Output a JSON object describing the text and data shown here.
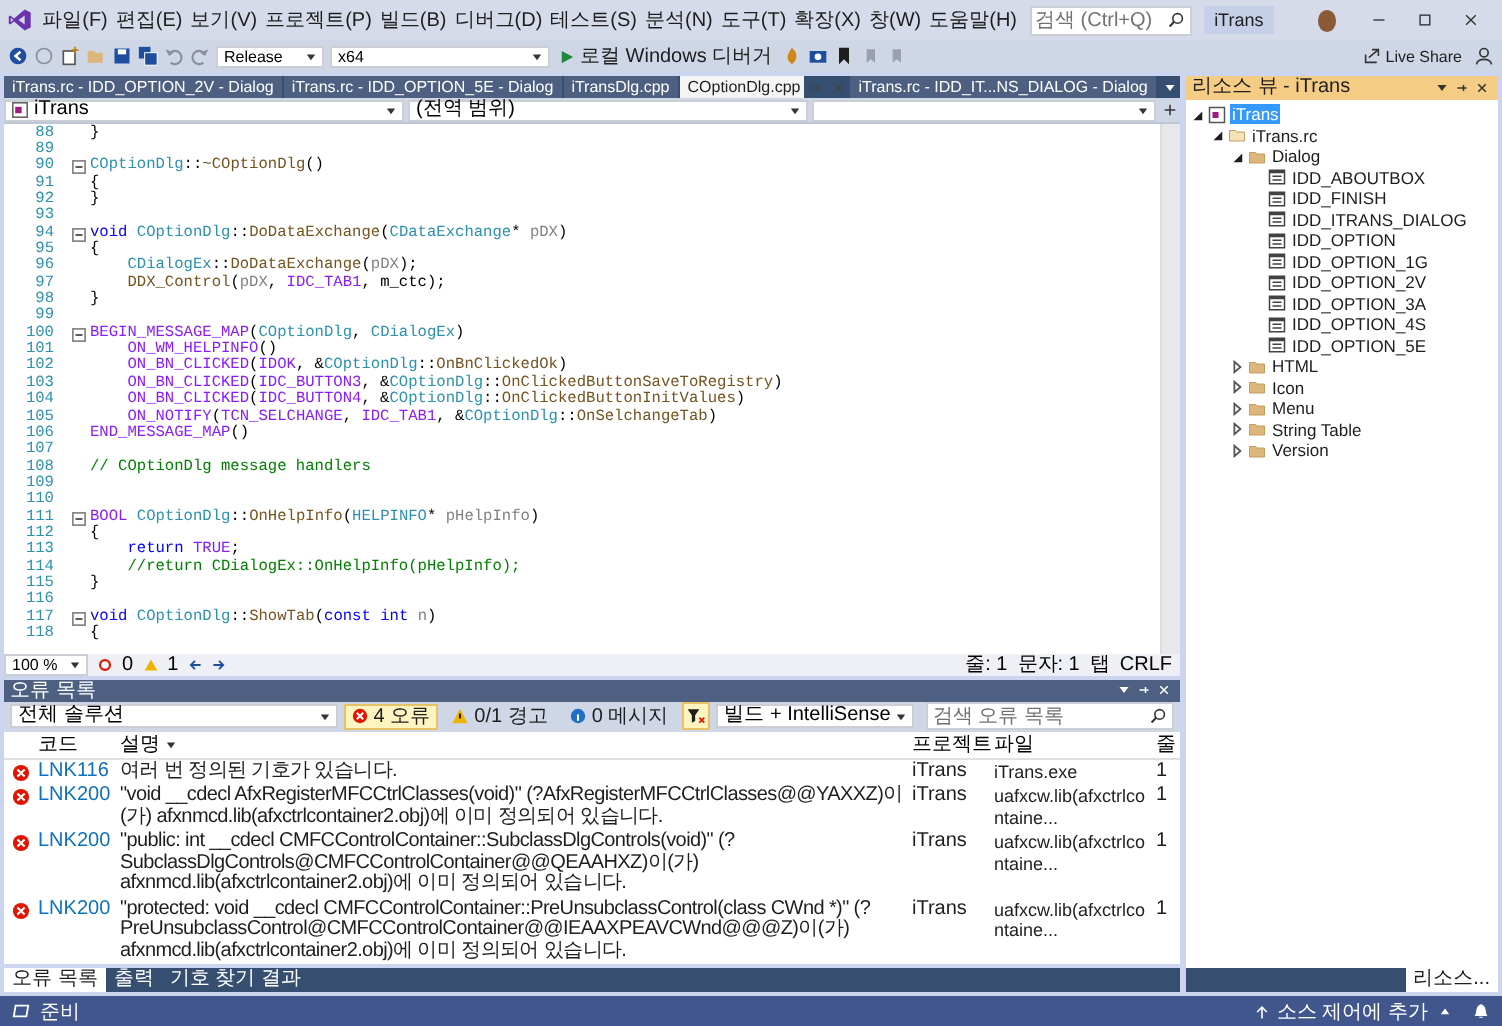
{
  "menu_bar": {
    "items": [
      "파일(F)",
      "편집(E)",
      "보기(V)",
      "프로젝트(P)",
      "빌드(B)",
      "디버그(D)",
      "테스트(S)",
      "분석(N)",
      "도구(T)",
      "확장(X)",
      "창(W)",
      "도움말(H)"
    ],
    "search": {
      "placeholder": "검색 (Ctrl+Q)"
    },
    "title": "iTrans"
  },
  "toolbar": {
    "configuration": "Release",
    "platform": "x64",
    "debugger": "로컬 Windows 디버거",
    "live_share": "Live Share"
  },
  "document_tabs": [
    {
      "label": "iTrans.rc - IDD_OPTION_2V - Dialog",
      "selected": false
    },
    {
      "label": "iTrans.rc - IDD_OPTION_5E - Dialog",
      "selected": false
    },
    {
      "label": "iTransDlg.cpp",
      "selected": false
    },
    {
      "label": "COptionDlg.cpp",
      "selected": true
    },
    {
      "label": "iTrans.rc - IDD_IT...NS_DIALOG - Dialog",
      "selected": false
    }
  ],
  "navigation_bar": {
    "project": "iTrans",
    "scope": "(전역 범위)"
  },
  "editor": {
    "lines": [
      {
        "number": "88",
        "fold": false,
        "tokens": [
          {
            "kind": "plain",
            "text": "}"
          }
        ]
      },
      {
        "number": "89",
        "fold": false
      },
      {
        "number": "90",
        "fold": true,
        "tokens": [
          {
            "kind": "type",
            "text": "COptionDlg"
          },
          {
            "kind": "plain",
            "text": "::"
          },
          {
            "kind": "func",
            "text": "~COptionDlg"
          },
          {
            "kind": "plain",
            "text": "()"
          }
        ]
      },
      {
        "number": "91",
        "fold": false,
        "tokens": [
          {
            "kind": "plain",
            "text": "{"
          }
        ]
      },
      {
        "number": "92",
        "fold": false,
        "tokens": [
          {
            "kind": "plain",
            "text": "}"
          }
        ]
      },
      {
        "number": "93",
        "fold": false
      },
      {
        "number": "94",
        "fold": true,
        "tokens": [
          {
            "kind": "kw",
            "text": "void "
          },
          {
            "kind": "type",
            "text": "COptionDlg"
          },
          {
            "kind": "plain",
            "text": "::"
          },
          {
            "kind": "func",
            "text": "DoDataExchange"
          },
          {
            "kind": "plain",
            "text": "("
          },
          {
            "kind": "type",
            "text": "CDataExchange"
          },
          {
            "kind": "plain",
            "text": "* "
          },
          {
            "kind": "param",
            "text": "pDX"
          },
          {
            "kind": "plain",
            "text": ")"
          }
        ]
      },
      {
        "number": "95",
        "fold": false,
        "tokens": [
          {
            "kind": "plain",
            "text": "{"
          }
        ]
      },
      {
        "number": "96",
        "fold": false,
        "tokens": [
          {
            "kind": "type",
            "text": "    CDialogEx"
          },
          {
            "kind": "plain",
            "text": "::"
          },
          {
            "kind": "func",
            "text": "DoDataExchange"
          },
          {
            "kind": "plain",
            "text": "("
          },
          {
            "kind": "param",
            "text": "pDX"
          },
          {
            "kind": "plain",
            "text": ");"
          }
        ]
      },
      {
        "number": "97",
        "fold": false,
        "tokens": [
          {
            "kind": "func",
            "text": "    DDX_Control"
          },
          {
            "kind": "plain",
            "text": "("
          },
          {
            "kind": "param",
            "text": "pDX"
          },
          {
            "kind": "plain",
            "text": ", "
          },
          {
            "kind": "macro",
            "text": "IDC_TAB1"
          },
          {
            "kind": "plain",
            "text": ", m_ctc);"
          }
        ]
      },
      {
        "number": "98",
        "fold": false,
        "tokens": [
          {
            "kind": "plain",
            "text": "}"
          }
        ]
      },
      {
        "number": "99",
        "fold": false
      },
      {
        "number": "100",
        "fold": true,
        "tokens": [
          {
            "kind": "macro",
            "text": "BEGIN_MESSAGE_MAP"
          },
          {
            "kind": "plain",
            "text": "("
          },
          {
            "kind": "type",
            "text": "COptionDlg"
          },
          {
            "kind": "plain",
            "text": ", "
          },
          {
            "kind": "type",
            "text": "CDialogEx"
          },
          {
            "kind": "plain",
            "text": ")"
          }
        ]
      },
      {
        "number": "101",
        "fold": false,
        "tokens": [
          {
            "kind": "macro",
            "text": "    ON_WM_HELPINFO"
          },
          {
            "kind": "plain",
            "text": "()"
          }
        ]
      },
      {
        "number": "102",
        "fold": false,
        "tokens": [
          {
            "kind": "macro",
            "text": "    ON_BN_CLICKED"
          },
          {
            "kind": "plain",
            "text": "("
          },
          {
            "kind": "macro",
            "text": "IDOK"
          },
          {
            "kind": "plain",
            "text": ", &"
          },
          {
            "kind": "type",
            "text": "COptionDlg"
          },
          {
            "kind": "plain",
            "text": "::"
          },
          {
            "kind": "func",
            "text": "OnBnClickedOk"
          },
          {
            "kind": "plain",
            "text": ")"
          }
        ]
      },
      {
        "number": "103",
        "fold": false,
        "tokens": [
          {
            "kind": "macro",
            "text": "    ON_BN_CLICKED"
          },
          {
            "kind": "plain",
            "text": "("
          },
          {
            "kind": "macro",
            "text": "IDC_BUTTON3"
          },
          {
            "kind": "plain",
            "text": ", &"
          },
          {
            "kind": "type",
            "text": "COptionDlg"
          },
          {
            "kind": "plain",
            "text": "::"
          },
          {
            "kind": "func",
            "text": "OnClickedButtonSaveToRegistry"
          },
          {
            "kind": "plain",
            "text": ")"
          }
        ]
      },
      {
        "number": "104",
        "fold": false,
        "tokens": [
          {
            "kind": "macro",
            "text": "    ON_BN_CLICKED"
          },
          {
            "kind": "plain",
            "text": "("
          },
          {
            "kind": "macro",
            "text": "IDC_BUTTON4"
          },
          {
            "kind": "plain",
            "text": ", &"
          },
          {
            "kind": "type",
            "text": "COptionDlg"
          },
          {
            "kind": "plain",
            "text": "::"
          },
          {
            "kind": "func",
            "text": "OnClickedButtonInitValues"
          },
          {
            "kind": "plain",
            "text": ")"
          }
        ]
      },
      {
        "number": "105",
        "fold": false,
        "tokens": [
          {
            "kind": "macro",
            "text": "    ON_NOTIFY"
          },
          {
            "kind": "plain",
            "text": "("
          },
          {
            "kind": "macro",
            "text": "TCN_SELCHANGE"
          },
          {
            "kind": "plain",
            "text": ", "
          },
          {
            "kind": "macro",
            "text": "IDC_TAB1"
          },
          {
            "kind": "plain",
            "text": ", &"
          },
          {
            "kind": "type",
            "text": "COptionDlg"
          },
          {
            "kind": "plain",
            "text": "::"
          },
          {
            "kind": "func",
            "text": "OnSelchangeTab"
          },
          {
            "kind": "plain",
            "text": ")"
          }
        ]
      },
      {
        "number": "106",
        "fold": false,
        "tokens": [
          {
            "kind": "macro",
            "text": "END_MESSAGE_MAP"
          },
          {
            "kind": "plain",
            "text": "()"
          }
        ]
      },
      {
        "number": "107",
        "fold": false
      },
      {
        "number": "108",
        "fold": false,
        "tokens": [
          {
            "kind": "comment",
            "text": "// COptionDlg message handlers"
          }
        ]
      },
      {
        "number": "109",
        "fold": false
      },
      {
        "number": "110",
        "fold": false
      },
      {
        "number": "111",
        "fold": true,
        "tokens": [
          {
            "kind": "macro",
            "text": "BOOL "
          },
          {
            "kind": "type",
            "text": "COptionDlg"
          },
          {
            "kind": "plain",
            "text": "::"
          },
          {
            "kind": "func",
            "text": "OnHelpInfo"
          },
          {
            "kind": "plain",
            "text": "("
          },
          {
            "kind": "type",
            "text": "HELPINFO"
          },
          {
            "kind": "plain",
            "text": "* "
          },
          {
            "kind": "param",
            "text": "pHelpInfo"
          },
          {
            "kind": "plain",
            "text": ")"
          }
        ]
      },
      {
        "number": "112",
        "fold": false,
        "tokens": [
          {
            "kind": "plain",
            "text": "{"
          }
        ]
      },
      {
        "number": "113",
        "fold": false,
        "tokens": [
          {
            "kind": "kw",
            "text": "    return "
          },
          {
            "kind": "macro",
            "text": "TRUE"
          },
          {
            "kind": "plain",
            "text": ";"
          }
        ]
      },
      {
        "number": "114",
        "fold": false,
        "tokens": [
          {
            "kind": "comment",
            "text": "    //return CDialogEx::OnHelpInfo(pHelpInfo);"
          }
        ]
      },
      {
        "number": "115",
        "fold": false,
        "tokens": [
          {
            "kind": "plain",
            "text": "}"
          }
        ]
      },
      {
        "number": "116",
        "fold": false
      },
      {
        "number": "117",
        "fold": true,
        "tokens": [
          {
            "kind": "kw",
            "text": "void "
          },
          {
            "kind": "type",
            "text": "COptionDlg"
          },
          {
            "kind": "plain",
            "text": "::"
          },
          {
            "kind": "func",
            "text": "ShowTab"
          },
          {
            "kind": "plain",
            "text": "("
          },
          {
            "kind": "kw",
            "text": "const int "
          },
          {
            "kind": "param",
            "text": "n"
          },
          {
            "kind": "plain",
            "text": ")"
          }
        ]
      },
      {
        "number": "118",
        "fold": false,
        "tokens": [
          {
            "kind": "plain",
            "text": "{"
          }
        ]
      }
    ]
  },
  "editor_status": {
    "zoom": "100 %",
    "errors": "0",
    "warnings": "1",
    "line": "줄: 1",
    "char": "문자: 1",
    "indent": "탭",
    "line_ending": "CRLF"
  },
  "error_list": {
    "title": "오류 목록",
    "scope": "전체 솔루션",
    "filters": [
      {
        "kind": "error",
        "label": "4 오류",
        "selected": true
      },
      {
        "kind": "warning",
        "label": "0/1 경고",
        "selected": false
      },
      {
        "kind": "message",
        "label": "0 메시지",
        "selected": false
      }
    ],
    "source": "빌드 + IntelliSense",
    "search": {
      "placeholder": "검색 오류 목록"
    },
    "columns": [
      "코드",
      "설명",
      "프로젝트",
      "파일",
      "줄"
    ],
    "rows": [
      {
        "code": "LNK116",
        "description": "여러 번 정의된 기호가 있습니다.",
        "project": "iTrans",
        "file": "iTrans.exe",
        "line": "1"
      },
      {
        "code": "LNK200",
        "description": "\"void __cdecl AfxRegisterMFCCtrlClasses(void)\" (?AfxRegisterMFCCtrlClasses@@YAXXZ)이(가) afxnmcd.lib(afxctrlcontainer2.obj)에 이미 정의되어 있습니다.",
        "project": "iTrans",
        "file": "uafxcw.lib(afxctrlcontaine...",
        "line": "1"
      },
      {
        "code": "LNK200",
        "description": "\"public: int __cdecl CMFCControlContainer::SubclassDlgControls(void)\" (?SubclassDlgControls@CMFCControlContainer@@QEAAHXZ)이(가) afxnmcd.lib(afxctrlcontainer2.obj)에 이미 정의되어 있습니다.",
        "project": "iTrans",
        "file": "uafxcw.lib(afxctrlcontaine...",
        "line": "1"
      },
      {
        "code": "LNK200",
        "description": "\"protected: void __cdecl CMFCControlContainer::PreUnsubclassControl(class CWnd *)\" (?PreUnsubclassControl@CMFCControlContainer@@IEAAXPEAVCWnd@@@Z)이(가) afxnmcd.lib(afxctrlcontainer2.obj)에 이미 정의되어 있습니다.",
        "project": "iTrans",
        "file": "uafxcw.lib(afxctrlcontaine...",
        "line": "1"
      }
    ]
  },
  "bottom_tabs": [
    {
      "label": "오류 목록",
      "selected": true
    },
    {
      "label": "출력",
      "selected": false
    },
    {
      "label": "기호 찾기 결과",
      "selected": false
    }
  ],
  "resource_view": {
    "title": "리소스 뷰 - iTrans",
    "tree": [
      {
        "kind": "project",
        "label": "iTrans",
        "expanded": true,
        "selected": true,
        "children": [
          {
            "kind": "file",
            "label": "iTrans.rc",
            "expanded": true,
            "selected": false,
            "children": [
              {
                "kind": "folder",
                "label": "Dialog",
                "expanded": true,
                "selected": false,
                "children": [
                  {
                    "kind": "dialog",
                    "label": "IDD_ABOUTBOX",
                    "selected": false
                  },
                  {
                    "kind": "dialog",
                    "label": "IDD_FINISH",
                    "selected": false
                  },
                  {
                    "kind": "dialog",
                    "label": "IDD_ITRANS_DIALOG",
                    "selected": false
                  },
                  {
                    "kind": "dialog",
                    "label": "IDD_OPTION",
                    "selected": false
                  },
                  {
                    "kind": "dialog",
                    "label": "IDD_OPTION_1G",
                    "selected": false
                  },
                  {
                    "kind": "dialog",
                    "label": "IDD_OPTION_2V",
                    "selected": false
                  },
                  {
                    "kind": "dialog",
                    "label": "IDD_OPTION_3A",
                    "selected": false
                  },
                  {
                    "kind": "dialog",
                    "label": "IDD_OPTION_4S",
                    "selected": false
                  },
                  {
                    "kind": "dialog",
                    "label": "IDD_OPTION_5E",
                    "selected": false
                  }
                ]
              },
              {
                "kind": "folder",
                "label": "HTML",
                "expanded": false,
                "selected": false
              },
              {
                "kind": "folder",
                "label": "Icon",
                "expanded": false,
                "selected": false
              },
              {
                "kind": "folder",
                "label": "Menu",
                "expanded": false,
                "selected": false
              },
              {
                "kind": "folder",
                "label": "String Table",
                "expanded": false,
                "selected": false
              },
              {
                "kind": "folder",
                "label": "Version",
                "expanded": false,
                "selected": false
              }
            ]
          }
        ]
      }
    ],
    "tabs": [
      {
        "label": "리소스...",
        "selected": true
      }
    ]
  },
  "status_bar": {
    "status": "준비",
    "source_control": "소스 제어에 추가"
  }
}
